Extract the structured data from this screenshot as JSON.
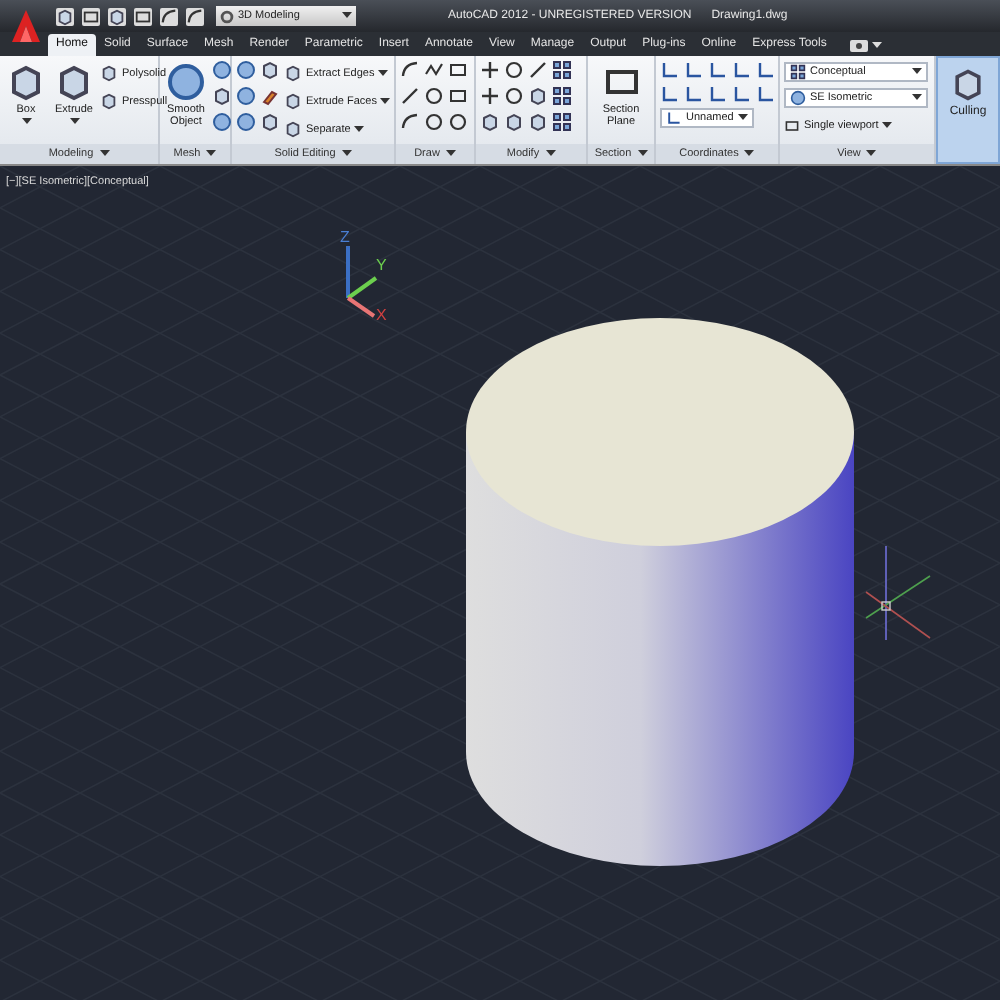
{
  "title_bar": {
    "workspace": "3D Modeling",
    "title": "AutoCAD 2012 - UNREGISTERED VERSION",
    "file": "Drawing1.dwg"
  },
  "tabs": [
    {
      "label": "Home",
      "selected": true
    },
    {
      "label": "Solid",
      "selected": false
    },
    {
      "label": "Surface",
      "selected": false
    },
    {
      "label": "Mesh",
      "selected": false
    },
    {
      "label": "Render",
      "selected": false
    },
    {
      "label": "Parametric",
      "selected": false
    },
    {
      "label": "Insert",
      "selected": false
    },
    {
      "label": "Annotate",
      "selected": false
    },
    {
      "label": "View",
      "selected": false
    },
    {
      "label": "Manage",
      "selected": false
    },
    {
      "label": "Output",
      "selected": false
    },
    {
      "label": "Plug-ins",
      "selected": false
    },
    {
      "label": "Online",
      "selected": false
    },
    {
      "label": "Express Tools",
      "selected": false
    }
  ],
  "panels": [
    {
      "kind": "modeling",
      "label": "Modeling",
      "items": [
        {
          "kind": "large",
          "label": "Box",
          "menu": true
        },
        {
          "kind": "large",
          "label": "Extrude",
          "menu": true
        },
        {
          "kind": "small",
          "label": "Polysolid",
          "menu": false
        },
        {
          "kind": "small",
          "label": "Presspull",
          "menu": false
        }
      ]
    },
    {
      "kind": "mesh",
      "label": "Mesh",
      "items": [
        {
          "kind": "large",
          "label": "Smooth Object",
          "menu": false
        }
      ]
    },
    {
      "kind": "solid_editing",
      "label": "Solid Editing",
      "items": [
        {
          "kind": "small",
          "label": "Extract Edges",
          "menu": true
        },
        {
          "kind": "small",
          "label": "Extrude Faces",
          "menu": true
        },
        {
          "kind": "small",
          "label": "Separate",
          "menu": true
        }
      ]
    },
    {
      "kind": "draw",
      "label": "Draw"
    },
    {
      "kind": "modify",
      "label": "Modify"
    },
    {
      "kind": "section",
      "label": "Section",
      "items": [
        {
          "kind": "large",
          "label": "Section Plane",
          "menu": false
        }
      ]
    },
    {
      "kind": "coordinates",
      "label": "Coordinates",
      "items": [
        {
          "kind": "dropdown",
          "label": "Unnamed",
          "menu": true
        }
      ]
    },
    {
      "kind": "view",
      "label": "View",
      "items": [
        {
          "kind": "dropdown",
          "label": "Conceptual",
          "menu": true
        },
        {
          "kind": "dropdown",
          "label": "SE Isometric",
          "menu": true
        },
        {
          "kind": "small",
          "label": "Single viewport",
          "menu": true
        }
      ]
    }
  ],
  "culling_button": {
    "label": "Culling",
    "on": true
  },
  "viewport": {
    "controls": "[−]",
    "view": "[SE Isometric]",
    "style": "[Conceptual]",
    "axis_labels": [
      "Z",
      "Y",
      "X"
    ]
  }
}
